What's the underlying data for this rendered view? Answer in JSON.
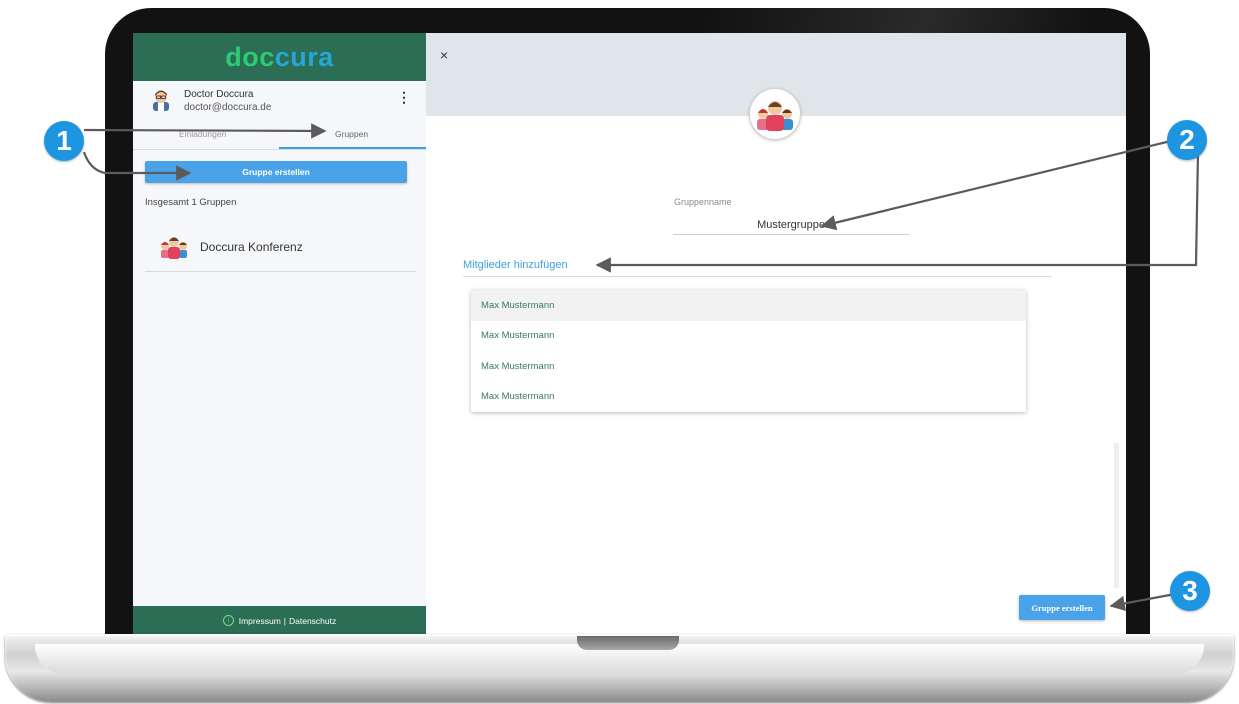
{
  "sidebar": {
    "logo_part1": "doc",
    "logo_part2": "cura",
    "profile": {
      "name": "Doctor Doccura",
      "email": "doctor@doccura.de",
      "menu_icon": "kebab-icon"
    },
    "tabs": [
      "Einladungen",
      "Gruppen"
    ],
    "create_button": "Gruppe erstellen",
    "total_label": "Insgesamt 1 Gruppen",
    "groups": [
      {
        "name": "Doccura Konferenz"
      }
    ],
    "footer": {
      "impressum": "Impressum",
      "separator": "|",
      "datenschutz": "Datenschutz"
    }
  },
  "dialog": {
    "close": "×",
    "group_name_label": "Gruppenname",
    "group_name_value": "Mustergruppe",
    "members_label": "Mitglieder hinzufügen",
    "members": [
      "Max Mustermann",
      "Max Mustermann",
      "Max Mustermann",
      "Max Mustermann"
    ],
    "submit_button": "Gruppe erstellen"
  },
  "annotations": [
    "1",
    "2",
    "3"
  ],
  "colors": {
    "brand_green": "#2b6d55",
    "logo_green": "#2ecc71",
    "logo_blue": "#27a7d8",
    "accent_blue": "#4aa3e8",
    "badge_blue": "#1d95e0",
    "member_text": "#3a7a5a"
  }
}
